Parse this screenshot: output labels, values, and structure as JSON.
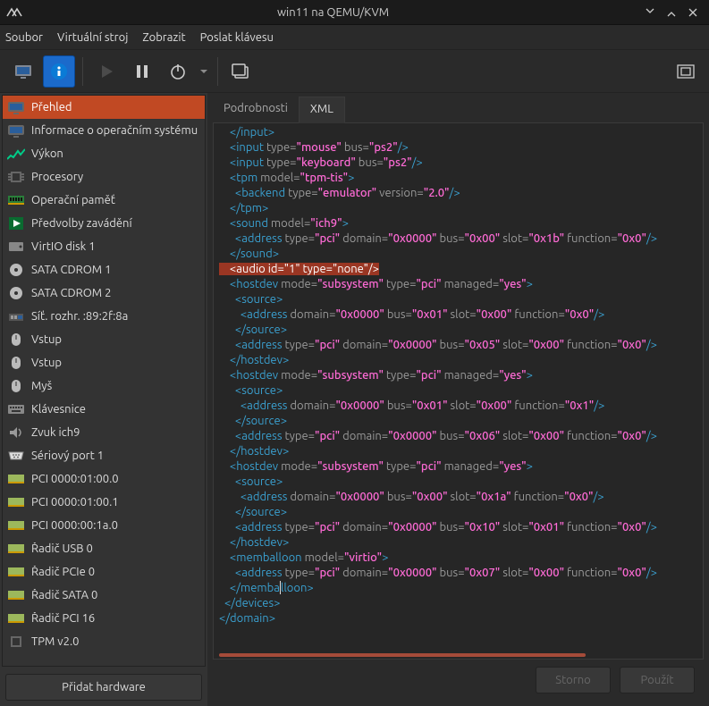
{
  "window": {
    "title": "win11 na QEMU/KVM"
  },
  "menu": {
    "file": "Soubor",
    "vm": "Virtuální stroj",
    "view": "Zobrazit",
    "sendkey": "Poslat klávesu"
  },
  "sidebar": {
    "items": [
      {
        "label": "Přehled"
      },
      {
        "label": "Informace o operačním systému"
      },
      {
        "label": "Výkon"
      },
      {
        "label": "Procesory"
      },
      {
        "label": "Operační paměť"
      },
      {
        "label": "Předvolby zavádění"
      },
      {
        "label": "VirtIO disk 1"
      },
      {
        "label": "SATA CDROM 1"
      },
      {
        "label": "SATA CDROM 2"
      },
      {
        "label": "Síť. rozhr. :89:2f:8a"
      },
      {
        "label": "Vstup"
      },
      {
        "label": "Vstup"
      },
      {
        "label": "Myš"
      },
      {
        "label": "Klávesnice"
      },
      {
        "label": "Zvuk ich9"
      },
      {
        "label": "Sériový port 1"
      },
      {
        "label": "PCI 0000:01:00.0"
      },
      {
        "label": "PCI 0000:01:00.1"
      },
      {
        "label": "PCI 0000:00:1a.0"
      },
      {
        "label": "Řadič USB 0"
      },
      {
        "label": "Řadič PCIe 0"
      },
      {
        "label": "Řadič SATA 0"
      },
      {
        "label": "Řadič PCI 16"
      },
      {
        "label": "TPM v2.0"
      }
    ],
    "add_hardware": "Přidat hardware"
  },
  "tabs": {
    "details": "Podrobnosti",
    "xml": "XML"
  },
  "footer": {
    "cancel": "Storno",
    "apply": "Použít"
  },
  "xml": {
    "l01a": "    </",
    "l01b": "input",
    "l01c": ">",
    "l02a": "    <",
    "l02b": "input",
    "l02c": " type=",
    "l02d": "\"mouse\"",
    "l02e": " bus=",
    "l02f": "\"ps2\"",
    "l02g": "/>",
    "l03a": "    <",
    "l03b": "input",
    "l03c": " type=",
    "l03d": "\"keyboard\"",
    "l03e": " bus=",
    "l03f": "\"ps2\"",
    "l03g": "/>",
    "l04a": "    <",
    "l04b": "tpm",
    "l04c": " model=",
    "l04d": "\"tpm-tis\"",
    "l04e": ">",
    "l05a": "      <",
    "l05b": "backend",
    "l05c": " type=",
    "l05d": "\"emulator\"",
    "l05e": " version=",
    "l05f": "\"2.0\"",
    "l05g": "/>",
    "l06a": "    </",
    "l06b": "tpm",
    "l06c": ">",
    "l07a": "    <",
    "l07b": "sound",
    "l07c": " model=",
    "l07d": "\"ich9\"",
    "l07e": ">",
    "l08a": "      <",
    "l08b": "address",
    "l08c": " type=",
    "l08d": "\"pci\"",
    "l08e": " domain=",
    "l08f": "\"0x0000\"",
    "l08g": " bus=",
    "l08h": "\"0x00\"",
    "l08i": " slot=",
    "l08j": "\"0x1b\"",
    "l08k": " function=",
    "l08l": "\"0x0\"",
    "l08m": "/>",
    "l09a": "    </",
    "l09b": "sound",
    "l09c": ">",
    "l10": "    <audio id=\"1\" type=\"none\"/>",
    "l11a": "    <",
    "l11b": "hostdev",
    "l11c": " mode=",
    "l11d": "\"subsystem\"",
    "l11e": " type=",
    "l11f": "\"pci\"",
    "l11g": " managed=",
    "l11h": "\"yes\"",
    "l11i": ">",
    "l12a": "      <",
    "l12b": "source",
    "l12c": ">",
    "l13a": "        <",
    "l13b": "address",
    "l13c": " domain=",
    "l13d": "\"0x0000\"",
    "l13e": " bus=",
    "l13f": "\"0x01\"",
    "l13g": " slot=",
    "l13h": "\"0x00\"",
    "l13i": " function=",
    "l13j": "\"0x0\"",
    "l13k": "/>",
    "l14a": "      </",
    "l14b": "source",
    "l14c": ">",
    "l15a": "      <",
    "l15b": "address",
    "l15c": " type=",
    "l15d": "\"pci\"",
    "l15e": " domain=",
    "l15f": "\"0x0000\"",
    "l15g": " bus=",
    "l15h": "\"0x05\"",
    "l15i": " slot=",
    "l15j": "\"0x00\"",
    "l15k": " function=",
    "l15l": "\"0x0\"",
    "l15m": "/>",
    "l16a": "    </",
    "l16b": "hostdev",
    "l16c": ">",
    "l17a": "    <",
    "l17b": "hostdev",
    "l17c": " mode=",
    "l17d": "\"subsystem\"",
    "l17e": " type=",
    "l17f": "\"pci\"",
    "l17g": " managed=",
    "l17h": "\"yes\"",
    "l17i": ">",
    "l18a": "      <",
    "l18b": "source",
    "l18c": ">",
    "l19a": "        <",
    "l19b": "address",
    "l19c": " domain=",
    "l19d": "\"0x0000\"",
    "l19e": " bus=",
    "l19f": "\"0x01\"",
    "l19g": " slot=",
    "l19h": "\"0x00\"",
    "l19i": " function=",
    "l19j": "\"0x1\"",
    "l19k": "/>",
    "l20a": "      </",
    "l20b": "source",
    "l20c": ">",
    "l21a": "      <",
    "l21b": "address",
    "l21c": " type=",
    "l21d": "\"pci\"",
    "l21e": " domain=",
    "l21f": "\"0x0000\"",
    "l21g": " bus=",
    "l21h": "\"0x06\"",
    "l21i": " slot=",
    "l21j": "\"0x00\"",
    "l21k": " function=",
    "l21l": "\"0x0\"",
    "l21m": "/>",
    "l22a": "    </",
    "l22b": "hostdev",
    "l22c": ">",
    "l23a": "    <",
    "l23b": "hostdev",
    "l23c": " mode=",
    "l23d": "\"subsystem\"",
    "l23e": " type=",
    "l23f": "\"pci\"",
    "l23g": " managed=",
    "l23h": "\"yes\"",
    "l23i": ">",
    "l24a": "      <",
    "l24b": "source",
    "l24c": ">",
    "l25a": "        <",
    "l25b": "address",
    "l25c": " domain=",
    "l25d": "\"0x0000\"",
    "l25e": " bus=",
    "l25f": "\"0x00\"",
    "l25g": " slot=",
    "l25h": "\"0x1a\"",
    "l25i": " function=",
    "l25j": "\"0x0\"",
    "l25k": "/>",
    "l26a": "      </",
    "l26b": "source",
    "l26c": ">",
    "l27a": "      <",
    "l27b": "address",
    "l27c": " type=",
    "l27d": "\"pci\"",
    "l27e": " domain=",
    "l27f": "\"0x0000\"",
    "l27g": " bus=",
    "l27h": "\"0x10\"",
    "l27i": " slot=",
    "l27j": "\"0x01\"",
    "l27k": " function=",
    "l27l": "\"0x0\"",
    "l27m": "/>",
    "l28a": "    </",
    "l28b": "hostdev",
    "l28c": ">",
    "l29a": "    <",
    "l29b": "memballoon",
    "l29c": " model=",
    "l29d": "\"virtio\"",
    "l29e": ">",
    "l30a": "      <",
    "l30b": "address",
    "l30c": " type=",
    "l30d": "\"pci\"",
    "l30e": " domain=",
    "l30f": "\"0x0000\"",
    "l30g": " bus=",
    "l30h": "\"0x07\"",
    "l30i": " slot=",
    "l30j": "\"0x00\"",
    "l30k": " function=",
    "l30l": "\"0x0\"",
    "l30m": "/>",
    "l31a": "    </",
    "l31b": "memba",
    "l31c": "lloon",
    "l31d": ">",
    "l32a": "  </",
    "l32b": "devices",
    "l32c": ">",
    "l33a": "</",
    "l33b": "domain",
    "l33c": ">"
  }
}
